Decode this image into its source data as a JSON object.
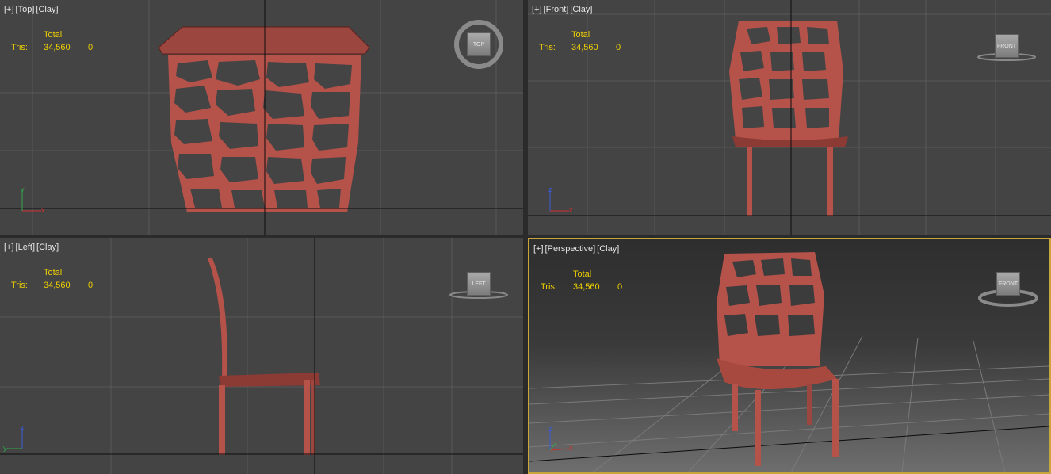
{
  "viewports": [
    {
      "id": "top",
      "label": [
        "[+]",
        "[Top]",
        "[Clay]"
      ],
      "cube_label": "TOP"
    },
    {
      "id": "front",
      "label": [
        "[+]",
        "[Front]",
        "[Clay]"
      ],
      "cube_label": "FRONT"
    },
    {
      "id": "left",
      "label": [
        "[+]",
        "[Left]",
        "[Clay]"
      ],
      "cube_label": "LEFT"
    },
    {
      "id": "perspective",
      "label": [
        "[+]",
        "[Perspective]",
        "[Clay]"
      ],
      "cube_label": "FRONT",
      "active": true
    }
  ],
  "stats": {
    "header": "Total",
    "row_label": "Tris:",
    "total": "34,560",
    "selected": "0"
  },
  "axes": {
    "x": "x",
    "y": "y",
    "z": "z"
  },
  "colors": {
    "viewport_bg": "#444444",
    "grid": "#595959",
    "origin_line": "#0c0c0c",
    "chair": "#b5524a",
    "chair_dark": "#6e2a25",
    "stats_text": "#f0d000",
    "active_border": "#c8a63c"
  }
}
